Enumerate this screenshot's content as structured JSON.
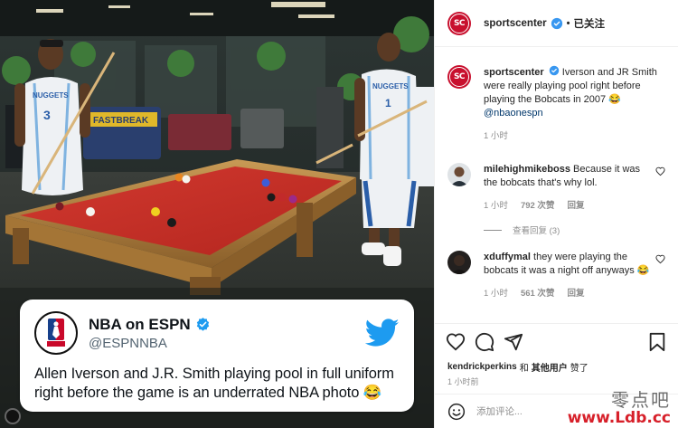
{
  "post": {
    "media": {
      "tweet": {
        "display_name": "NBA on ESPN",
        "handle": "@ESPNNBA",
        "text": "Allen Iverson and J.R. Smith playing pool in full uniform right before the game is an underrated NBA photo 😂",
        "avatar_icon": "nba-espn-logo",
        "brand_icon": "twitter-bird-icon"
      },
      "photo_signage": "FASTBREAK",
      "jersey_left": "NUGGETS",
      "jersey_left_number": "3",
      "jersey_right": "NUGGETS",
      "jersey_right_number": "1"
    },
    "header": {
      "username": "sportscenter",
      "separator": "•",
      "follow_status": "已关注"
    },
    "caption": {
      "username": "sportscenter",
      "text": "Iverson and JR Smith were really playing pool right before playing the Bobcats in 2007 😂",
      "mention": "@nbaonespn",
      "time": "1 小时"
    },
    "comments": [
      {
        "username": "milehighmikeboss",
        "text": "Because it was the bobcats that's why lol.",
        "time": "1 小时",
        "likes": "792 次赞",
        "reply": "回复",
        "view_replies": "查看回复 (3)"
      },
      {
        "username": "xduffymal",
        "text": "they were playing the bobcats it was a night off anyways 😂",
        "time": "1 小时",
        "likes": "561 次赞",
        "reply": "回复"
      }
    ],
    "likes_line": {
      "user": "kendrickperkins",
      "connector": "和",
      "others": "其他用户",
      "suffix": "赞了"
    },
    "post_time": "1 小时前",
    "comment_box": {
      "placeholder": "添加评论..."
    }
  },
  "watermark": {
    "cn": "零点吧",
    "url": "www.Ldb.cc"
  },
  "colors": {
    "verified": "#3897f0",
    "twitter": "#1d9bf0",
    "sportscenter_red": "#c8102e",
    "mention": "#00376b",
    "watermark_red": "#d7202a",
    "pool_felt": "#c9302a"
  }
}
